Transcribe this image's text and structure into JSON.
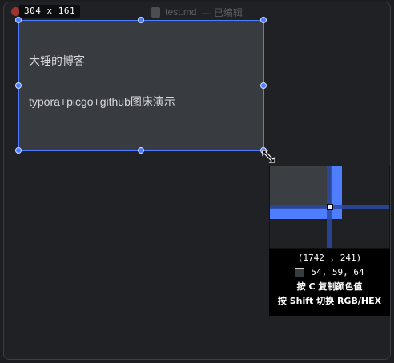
{
  "window": {
    "title": "test.md",
    "status": "— 已编辑"
  },
  "selection": {
    "size_label": "304 x 161",
    "lines": [
      "大锤的博客",
      "typora+picgo+github图床演示"
    ]
  },
  "magnifier": {
    "coordinates": "(1742 , 241)",
    "rgb": "54, 59, 64",
    "hint_copy": "按 C 复制颜色值",
    "hint_switch": "按 Shift 切换 RGB/HEX"
  },
  "colors": {
    "accent": "#4f7dff",
    "selection_fill": "#383b40",
    "picked_color": "#363b40"
  }
}
